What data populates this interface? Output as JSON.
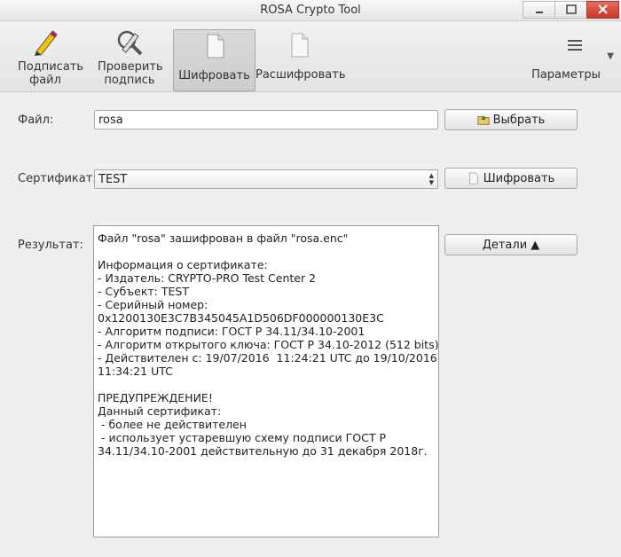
{
  "window": {
    "title": "ROSA Crypto Tool"
  },
  "toolbar": {
    "sign": "Подписать файл",
    "verify": "Проверить подпись",
    "encrypt": "Шифровать",
    "decrypt": "Расшифровать",
    "params": "Параметры"
  },
  "form": {
    "file_label": "Файл:",
    "file_value": "rosa",
    "choose_button": "Выбрать",
    "cert_label": "Сертификат:",
    "cert_value": "TEST",
    "encrypt_button": "Шифровать",
    "result_label": "Результат:",
    "details_button": "Детали ▲"
  },
  "result": {
    "lines": [
      "Файл \"rosa\" зашифрован в файл \"rosa.enc\"",
      "",
      "Информация о сертификате:",
      "- Издатель: CRYPTO-PRO Test Center 2",
      "- Субъект: TEST",
      "- Серийный номер:",
      "0x1200130E3C7B345045A1D506DF000000130E3C",
      "- Алгоритм подписи: ГОСТ Р 34.11/34.10-2001",
      "- Алгоритм открытого ключа: ГОСТ Р 34.10-2012 (512 bits)",
      "- Действителен с: 19/07/2016  11:24:21 UTC до 19/10/2016",
      "11:34:21 UTC",
      "",
      "ПРЕДУПРЕЖДЕНИЕ!",
      "Данный сертификат:",
      " - более не действителен",
      " - использует устаревшую схему подписи ГОСТ Р",
      "34.11/34.10-2001 действительную до 31 декабря 2018г."
    ]
  }
}
